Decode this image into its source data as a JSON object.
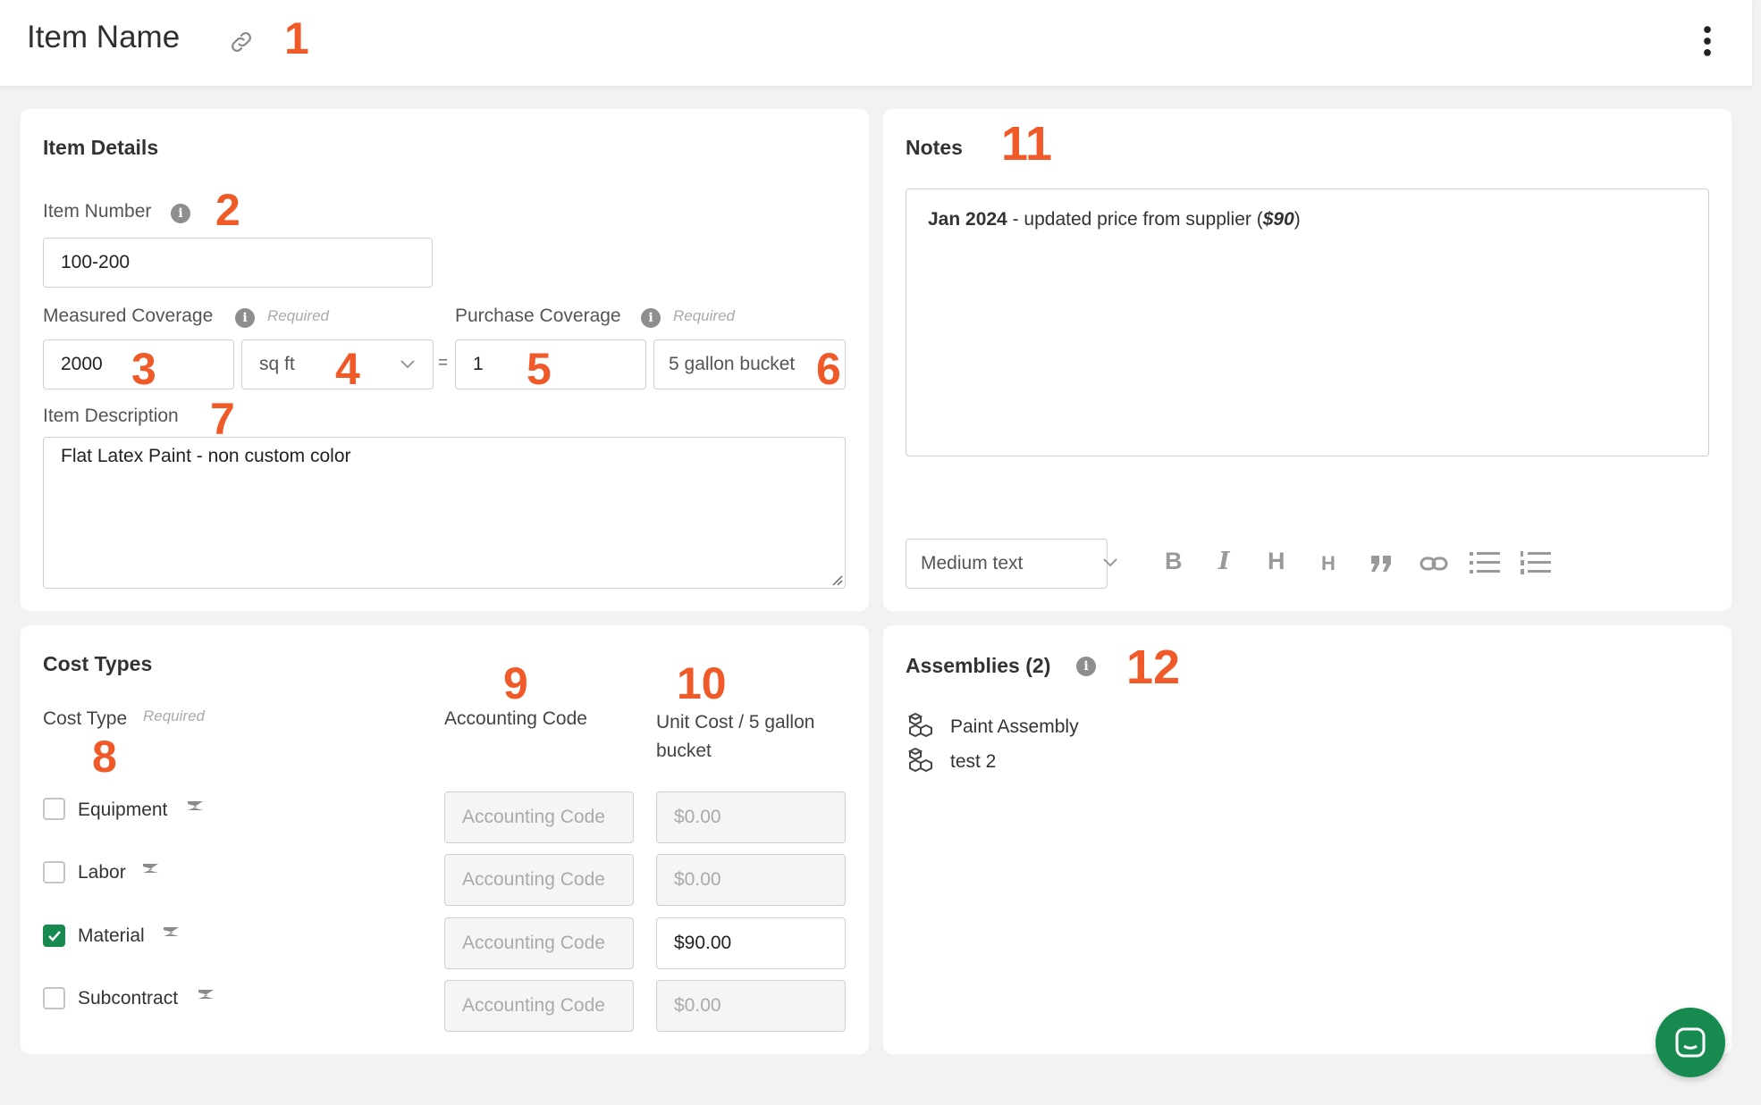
{
  "header": {
    "title": "Item Name"
  },
  "markers": [
    "1",
    "2",
    "3",
    "4",
    "5",
    "6",
    "7",
    "8",
    "9",
    "10",
    "11",
    "12"
  ],
  "item_details": {
    "title": "Item Details",
    "item_number_label": "Item Number",
    "item_number_value": "100-200",
    "measured_coverage_label": "Measured Coverage",
    "required": "Required",
    "measured_value": "2000",
    "unit_value": "sq ft",
    "equals": "=",
    "purchase_coverage_label": "Purchase Coverage",
    "purchase_value": "1",
    "purchase_unit_value": "5 gallon bucket",
    "description_label": "Item Description",
    "description_value": "Flat Latex Paint - non custom color"
  },
  "notes": {
    "title": "Notes",
    "content_bold": "Jan 2024",
    "content_text": " - updated price from supplier (",
    "content_price": "$90",
    "content_close": ")",
    "text_size_value": "Medium text",
    "toolbar": [
      "B",
      "I",
      "H",
      "H",
      "quote",
      "link",
      "bulleted-list",
      "numbered-list"
    ]
  },
  "cost_types": {
    "title": "Cost Types",
    "col_cost_type": "Cost Type",
    "required": "Required",
    "col_accounting": "Accounting Code",
    "col_unit_cost": "Unit Cost / 5 gallon bucket",
    "rows": [
      {
        "label": "Equipment",
        "checked": false,
        "accounting_placeholder": "Accounting Code",
        "unit_cost": "$0.00"
      },
      {
        "label": "Labor",
        "checked": false,
        "accounting_placeholder": "Accounting Code",
        "unit_cost": "$0.00"
      },
      {
        "label": "Material",
        "checked": true,
        "accounting_placeholder": "Accounting Code",
        "unit_cost": "$90.00"
      },
      {
        "label": "Subcontract",
        "checked": false,
        "accounting_placeholder": "Accounting Code",
        "unit_cost": "$0.00"
      }
    ]
  },
  "assemblies": {
    "title": "Assemblies (2)",
    "items": [
      "Paint Assembly",
      "test 2"
    ]
  },
  "colors": {
    "accent_green": "#168a4f",
    "marker_orange": "#f05a28"
  }
}
